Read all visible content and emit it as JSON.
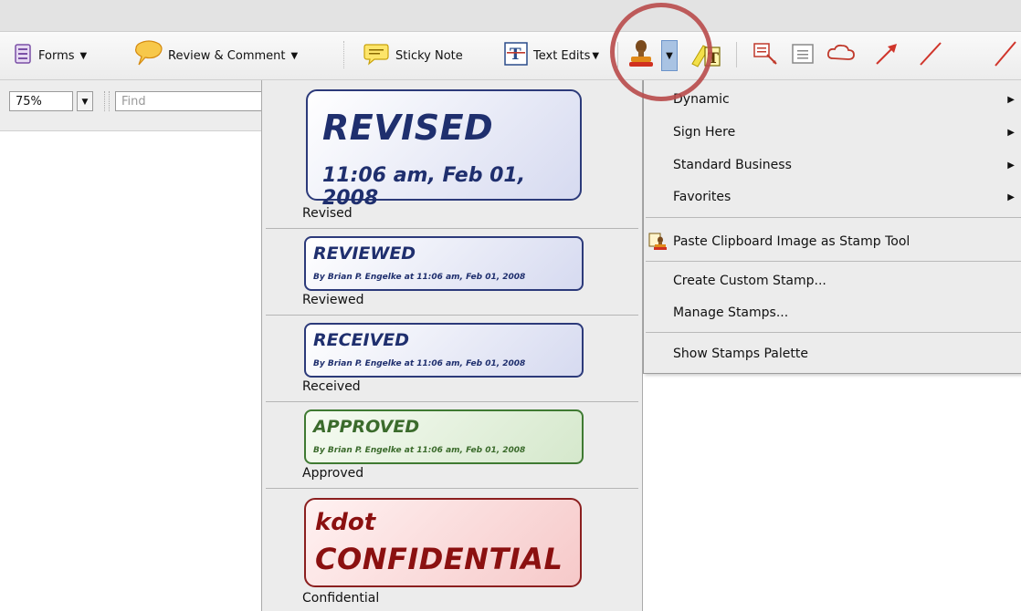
{
  "toolbar": {
    "forms_label": "Forms",
    "review_label": "Review & Comment",
    "sticky_label": "Sticky Note",
    "textedits_label": "Text Edits"
  },
  "view": {
    "zoom_value": "75%",
    "find_placeholder": "Find"
  },
  "stamps": [
    {
      "title": "REVISED",
      "subtitle": "11:06 am, Feb 01, 2008",
      "caption": "Revised",
      "style": "blue"
    },
    {
      "title": "REVIEWED",
      "subtitle": "By Brian P. Engelke at 11:06 am, Feb 01, 2008",
      "caption": "Reviewed",
      "style": "blue"
    },
    {
      "title": "RECEIVED",
      "subtitle": "By Brian P. Engelke at 11:06 am, Feb 01, 2008",
      "caption": "Received",
      "style": "blue"
    },
    {
      "title": "APPROVED",
      "subtitle": "By Brian P. Engelke at 11:06 am, Feb 01, 2008",
      "caption": "Approved",
      "style": "green"
    },
    {
      "title_top": "kdot",
      "title": "CONFIDENTIAL",
      "caption": "Confidential",
      "style": "red"
    }
  ],
  "menu": {
    "items": [
      {
        "label": "Dynamic"
      },
      {
        "label": "Sign Here"
      },
      {
        "label": "Standard Business"
      },
      {
        "label": "Favorites"
      },
      {
        "label": "Paste Clipboard Image as Stamp Tool"
      },
      {
        "label": "Create Custom Stamp..."
      },
      {
        "label": "Manage Stamps..."
      },
      {
        "label": "Show Stamps Palette"
      }
    ]
  },
  "colors": {
    "annotation_circle": "#b84a4a",
    "stamp_blue": "#1f2f6e",
    "stamp_green": "#3b6b2c",
    "stamp_red": "#8b1010"
  }
}
